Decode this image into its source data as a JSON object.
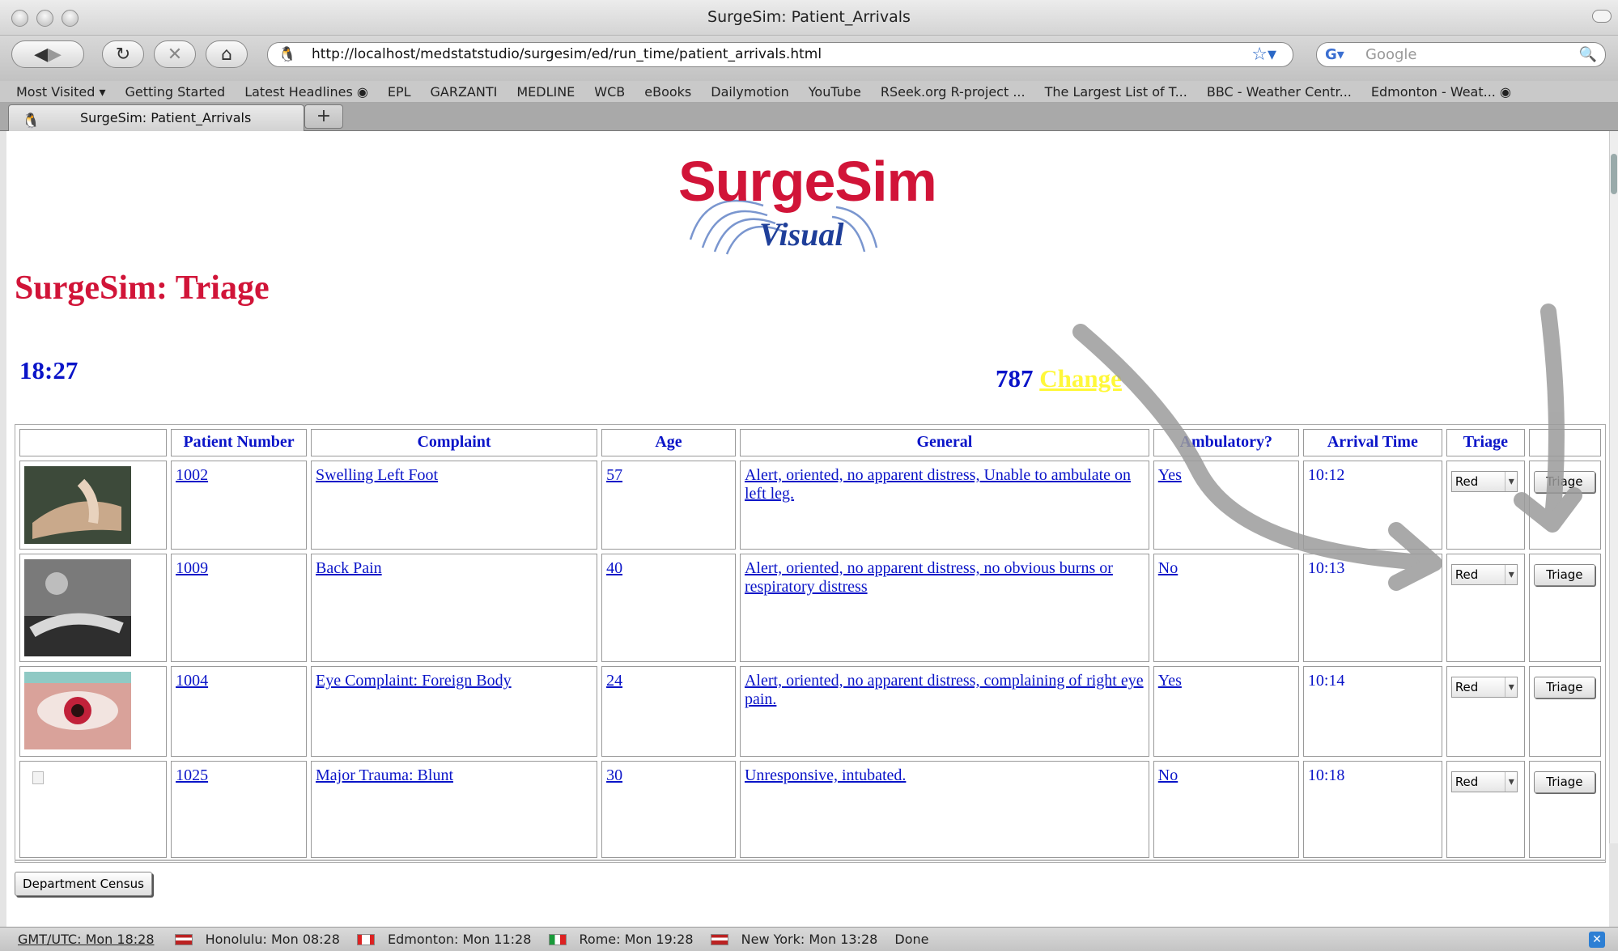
{
  "window": {
    "title": "SurgeSim: Patient_Arrivals"
  },
  "navbar": {
    "url": "http://localhost/medstatstudio/surgesim/ed/run_time/patient_arrivals.html",
    "search_placeholder": "Google"
  },
  "bookmarks": [
    "Most Visited ▾",
    "Getting Started",
    "Latest Headlines ◉",
    "EPL",
    "GARZANTI",
    "MEDLINE",
    "WCB",
    "eBooks",
    "Dailymotion",
    "YouTube",
    "RSeek.org R-project ...",
    "The Largest List of T...",
    "BBC - Weather Centr...",
    "Edmonton - Weat... ◉"
  ],
  "tab": {
    "label": "SurgeSim: Patient_Arrivals",
    "new_tab": "+"
  },
  "logo": {
    "main": "SurgeSim",
    "sub": "Visual"
  },
  "page": {
    "title": "SurgeSim: Triage",
    "clock": "18:27",
    "counter": "787",
    "change_link": "Change"
  },
  "table": {
    "headers": [
      "Patient Number",
      "Complaint",
      "Age",
      "General",
      "Ambulatory?",
      "Arrival Time",
      "Triage"
    ],
    "rows": [
      {
        "patient": "1002",
        "complaint": "Swelling Left Foot",
        "age": "57",
        "general": "Alert, oriented, no apparent distress, Unable to ambulate on left leg.",
        "ambulatory": "Yes",
        "arrival": "10:12",
        "triage": "Red",
        "button": "Triage"
      },
      {
        "patient": "1009",
        "complaint": "Back Pain",
        "age": "40",
        "general": "Alert, oriented, no apparent distress, no obvious burns or respiratory distress",
        "ambulatory": "No",
        "arrival": "10:13",
        "triage": "Red",
        "button": "Triage"
      },
      {
        "patient": "1004",
        "complaint": "Eye Complaint: Foreign Body",
        "age": "24",
        "general": "Alert, oriented, no apparent distress, complaining of right eye pain.",
        "ambulatory": "Yes",
        "arrival": "10:14",
        "triage": "Red",
        "button": "Triage"
      },
      {
        "patient": "1025",
        "complaint": "Major Trauma: Blunt",
        "age": "30",
        "general": "Unresponsive, intubated.",
        "ambulatory": "No",
        "arrival": "10:18",
        "triage": "Red",
        "button": "Triage"
      }
    ]
  },
  "census_button": "Department Census",
  "status": {
    "utc": "GMT/UTC: Mon 18:28",
    "honolulu": "Honolulu: Mon 08:28",
    "edmonton": "Edmonton: Mon 11:28",
    "rome": "Rome: Mon 19:28",
    "newyork": "New York: Mon 13:28",
    "state": "Done"
  },
  "colors": {
    "brand_red": "#d11438",
    "link_blue": "#0a14c8",
    "change_yellow": "#fff83a"
  }
}
